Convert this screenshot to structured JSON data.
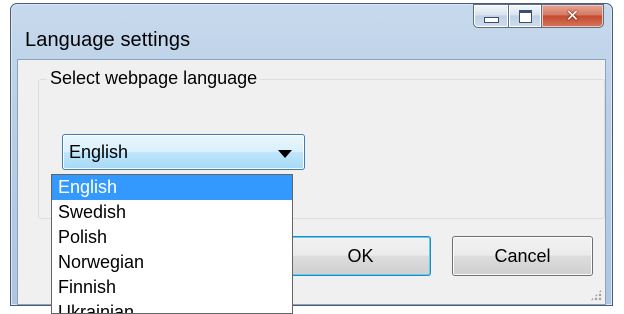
{
  "window": {
    "title": "Language settings",
    "caption_buttons": {
      "minimize": "minimize-icon",
      "maximize": "maximize-icon",
      "close": "close-icon"
    }
  },
  "group": {
    "label": "Select webpage language"
  },
  "combo": {
    "selected": "English",
    "arrow_icon": "chevron-down-icon",
    "options": [
      "English",
      "Swedish",
      "Polish",
      "Norwegian",
      "Finnish",
      "Ukrainian"
    ],
    "highlighted_index": 0
  },
  "buttons": {
    "ok": "OK",
    "cancel": "Cancel"
  },
  "colors": {
    "selection": "#3399ff",
    "close_button": "#c24a2f",
    "focus_border": "#3c7fb1"
  }
}
